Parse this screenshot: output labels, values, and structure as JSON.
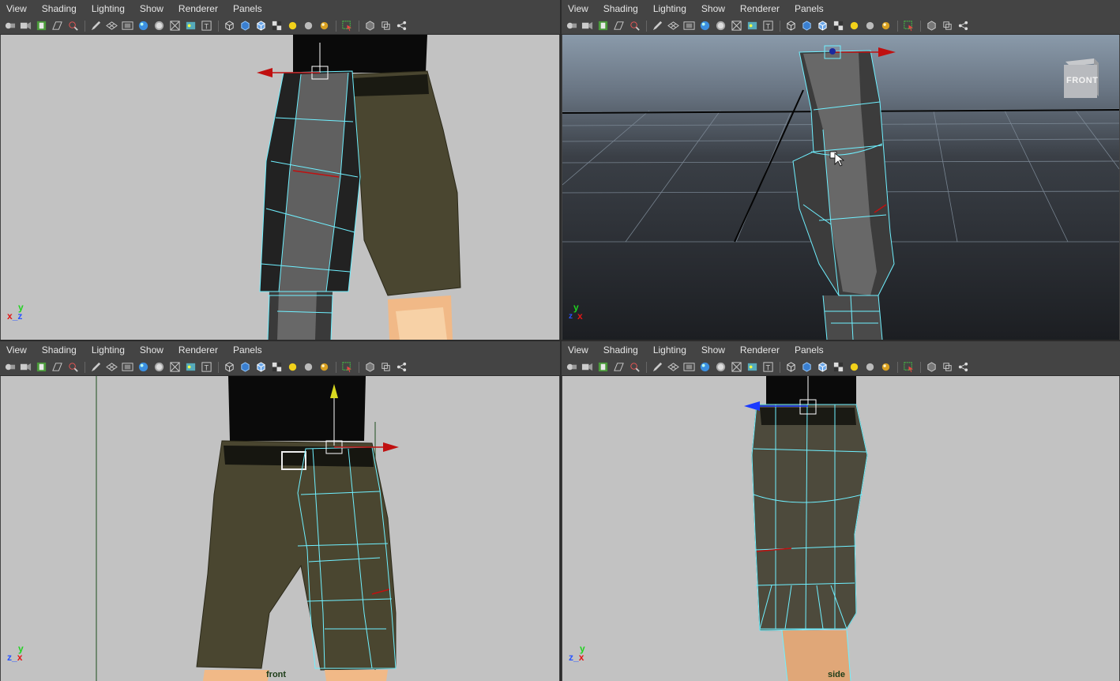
{
  "menu": [
    "View",
    "Shading",
    "Lighting",
    "Show",
    "Renderer",
    "Panels"
  ],
  "toolbar_icons": [
    "camera-select-icon",
    "camera-attributes-icon",
    "bookmark-icon",
    "image-plane-icon",
    "2d-pan-zoom-icon",
    "grease-pencil-icon",
    "grid-icon",
    "film-gate-icon",
    "resolution-gate-icon",
    "gate-mask-icon",
    "field-chart-icon",
    "safe-action-icon",
    "safe-title-icon",
    "wireframe-icon",
    "smooth-shade-icon",
    "wireframe-on-shaded-icon",
    "textured-icon",
    "use-all-lights-icon",
    "shadows-icon",
    "ambient-occlusion-icon",
    "isolate-select-icon",
    "xray-icon",
    "xray-joints-icon",
    "xray-active-icon"
  ],
  "viewports": [
    {
      "name": "top",
      "axis": {
        "up": "y",
        "left": "x",
        "right": "z"
      },
      "label": ""
    },
    {
      "name": "persp",
      "axis": {
        "up": "y",
        "left": "z",
        "right": "x"
      },
      "label": "",
      "view_cube": "FRONT"
    },
    {
      "name": "front",
      "axis": {
        "up": "y",
        "left": "z",
        "right": "x"
      },
      "label": "front"
    },
    {
      "name": "side",
      "axis": {
        "up": "y",
        "left": "z",
        "right": "x"
      },
      "label": "side"
    }
  ],
  "colors": {
    "viewport_bg": "#c2c2c2",
    "persp_bg_top": "#8a9aaa",
    "persp_bg_bottom": "#1c1e22",
    "wire": "#6ff0ff",
    "pants": "#4a4630",
    "shirt": "#0a0a0a",
    "skin": "#f1b987",
    "ui_bg": "#444444"
  }
}
